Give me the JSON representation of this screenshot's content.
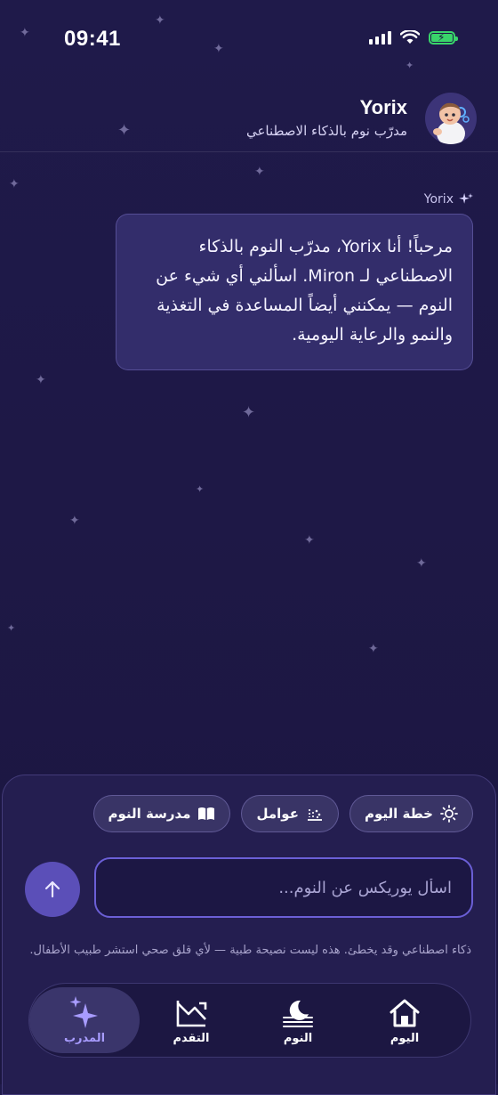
{
  "status_bar": {
    "time": "09:41"
  },
  "header": {
    "coach_name": "Yorix",
    "coach_subtitle": "مدرّب نوم بالذكاء الاصطناعي"
  },
  "chat": {
    "messages": [
      {
        "sender": "Yorix",
        "text": "مرحباً! أنا Yorix، مدرّب النوم بالذكاء الاصطناعي لـ Miron. اسألني أي شيء عن النوم — يمكنني أيضاً المساعدة في التغذية والنمو والرعاية اليومية."
      }
    ]
  },
  "quick_actions": [
    {
      "label": "مدرسة النوم",
      "icon": "book-icon"
    },
    {
      "label": "عوامل",
      "icon": "factors-icon"
    },
    {
      "label": "خطة اليوم",
      "icon": "sun-icon"
    }
  ],
  "composer": {
    "placeholder": "اسأل يوريكس عن النوم..."
  },
  "disclaimer": "ذكاء اصطناعي وقد يخطئ. هذه ليست نصيحة طبية — لأي قلق صحي استشر طبيب الأطفال.",
  "tabs": [
    {
      "label": "اليوم",
      "icon": "home-icon"
    },
    {
      "label": "النوم",
      "icon": "moon-icon"
    },
    {
      "label": "التقدم",
      "icon": "chart-icon"
    },
    {
      "label": "المدرب",
      "icon": "sparkles-icon",
      "active": true
    }
  ],
  "colors": {
    "accent": "#8b7cff",
    "background": "#1f1a4a",
    "bubble": "#332d6b"
  }
}
